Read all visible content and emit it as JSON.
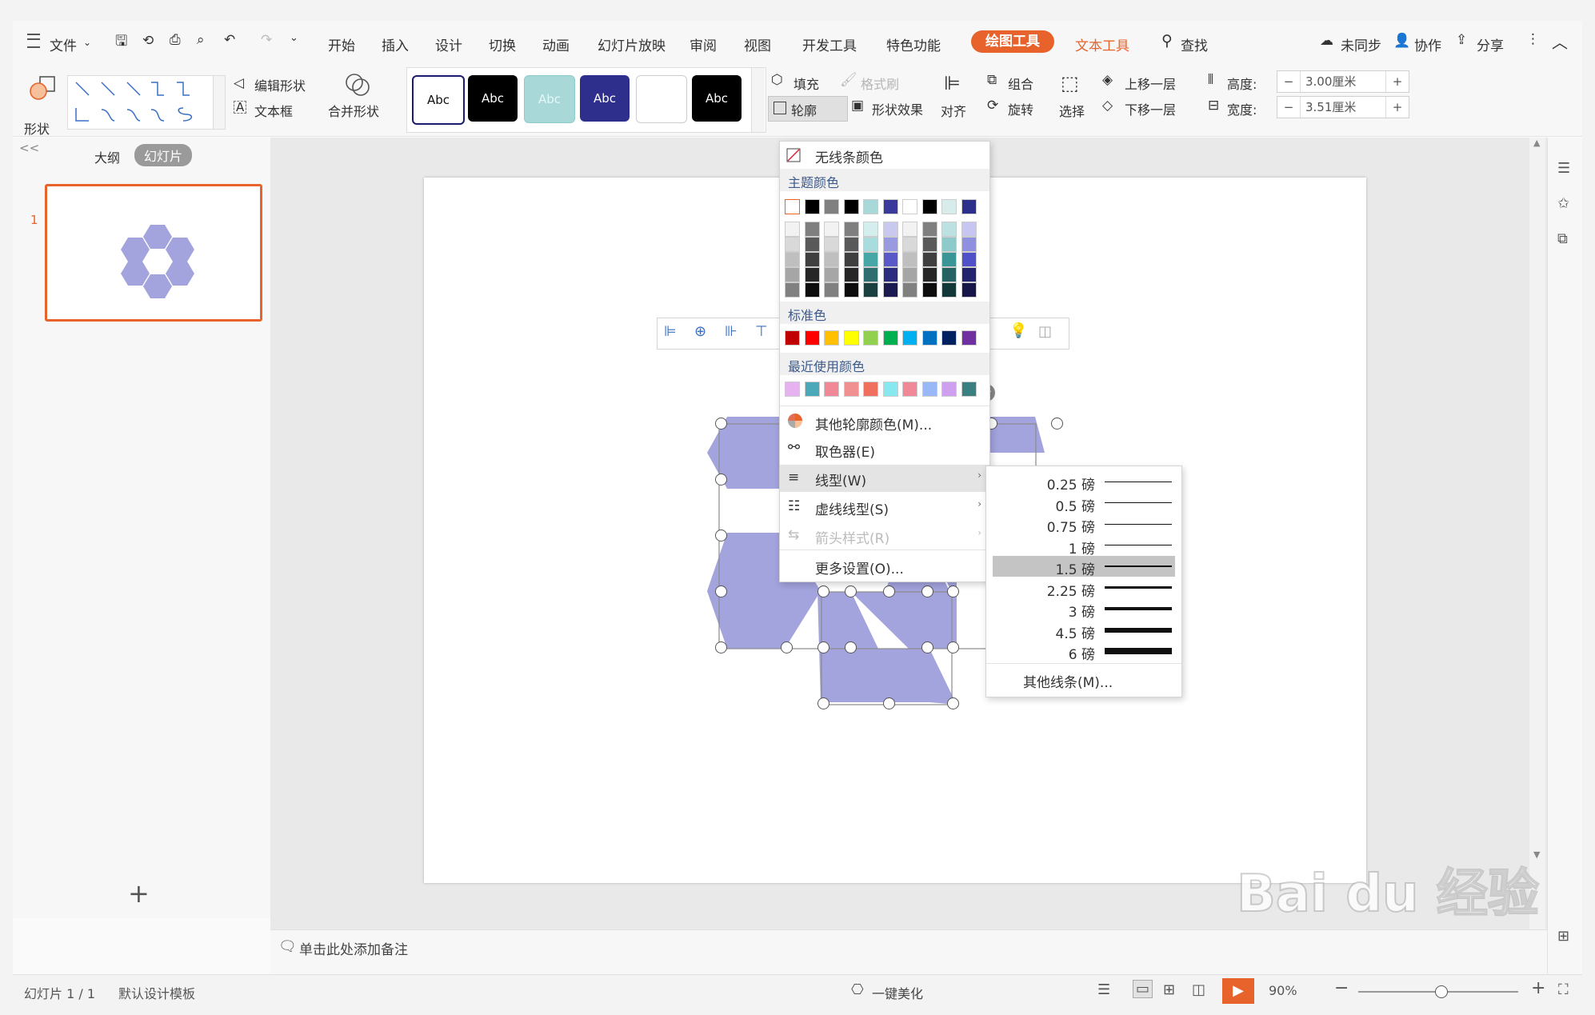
{
  "menubar": {
    "file": "文件",
    "tabs": [
      "开始",
      "插入",
      "设计",
      "切换",
      "动画",
      "幻灯片放映",
      "审阅",
      "视图",
      "开发工具",
      "特色功能"
    ],
    "active_tab": "绘图工具",
    "text_tool": "文本工具",
    "search": "查找",
    "sync": "未同步",
    "collab": "协作",
    "share": "分享"
  },
  "ribbon": {
    "shape": "形状",
    "edit_shape": "编辑形状",
    "textbox": "文本框",
    "merge_shape": "合并形状",
    "style_sample": "Abc",
    "fill": "填充",
    "format_painter": "格式刷",
    "outline": "轮廓",
    "shape_effect": "形状效果",
    "align": "对齐",
    "group": "组合",
    "rotate": "旋转",
    "select": "选择",
    "bring_forward": "上移一层",
    "send_backward": "下移一层",
    "height_label": "高度:",
    "height_value": "3.00厘米",
    "width_label": "宽度:",
    "width_value": "3.51厘米",
    "minus": "−",
    "plus": "+"
  },
  "left_panel": {
    "outline_tab": "大纲",
    "slides_tab": "幻灯片",
    "slide_number": "1",
    "add": "+",
    "collapse": "<<"
  },
  "notes": {
    "placeholder": "单击此处添加备注"
  },
  "status": {
    "slide_info": "幻灯片 1 / 1",
    "template": "默认设计模板",
    "beautify": "一键美化",
    "zoom": "90%"
  },
  "dropdown": {
    "no_line": "无线条颜色",
    "theme_colors": "主题颜色",
    "standard_colors": "标准色",
    "recent_colors": "最近使用颜色",
    "more_colors": "其他轮廓颜色(M)...",
    "eyedropper": "取色器(E)",
    "line_type": "线型(W)",
    "dash_type": "虚线线型(S)",
    "arrow_style": "箭头样式(R)",
    "more_settings": "更多设置(O)...",
    "theme_top": [
      "#ffffff",
      "#000000",
      "#808080",
      "#000000",
      "#a8d8d8",
      "#3a3a9c",
      "#ffffff",
      "#000000",
      "#d8ecec",
      "#2e2e8c"
    ],
    "theme_shades": [
      [
        "#f2f2f2",
        "#7f7f7f",
        "#f2f2f2",
        "#7f7f7f",
        "#d4eeee",
        "#c9c9ef",
        "#f2f2f2",
        "#7f7f7f",
        "#bde0e0",
        "#c6c6f0"
      ],
      [
        "#d9d9d9",
        "#595959",
        "#d9d9d9",
        "#595959",
        "#a9dcdc",
        "#9a9ae0",
        "#d9d9d9",
        "#595959",
        "#8fcaca",
        "#9090e0"
      ],
      [
        "#bfbfbf",
        "#3f3f3f",
        "#bfbfbf",
        "#3f3f3f",
        "#47a7a7",
        "#5959c8",
        "#bfbfbf",
        "#3f3f3f",
        "#3a9696",
        "#5050c8"
      ],
      [
        "#a6a6a6",
        "#262626",
        "#a6a6a6",
        "#262626",
        "#2e6e6e",
        "#2b2b80",
        "#a6a6a6",
        "#262626",
        "#256363",
        "#23236e"
      ],
      [
        "#808080",
        "#0d0d0d",
        "#808080",
        "#0d0d0d",
        "#1a4040",
        "#1b1b52",
        "#808080",
        "#0d0d0d",
        "#133838",
        "#161648"
      ]
    ],
    "standard": [
      "#c00000",
      "#ff0000",
      "#ffc000",
      "#ffff00",
      "#92d050",
      "#00b050",
      "#00b0f0",
      "#0070c0",
      "#002060",
      "#7030a0"
    ],
    "recent": [
      "#e6b3f0",
      "#4aa8b8",
      "#f08898",
      "#f09090",
      "#f07060",
      "#88e8f0",
      "#f08898",
      "#98b8f8",
      "#d0a0f0",
      "#3a8080"
    ]
  },
  "line_weights": [
    {
      "label": "0.25 磅",
      "w": 0.25
    },
    {
      "label": "0.5 磅",
      "w": 0.5
    },
    {
      "label": "0.75 磅",
      "w": 0.75
    },
    {
      "label": "1 磅",
      "w": 1
    },
    {
      "label": "1.5 磅",
      "w": 1.5
    },
    {
      "label": "2.25 磅",
      "w": 2.25
    },
    {
      "label": "3 磅",
      "w": 3
    },
    {
      "label": "4.5 磅",
      "w": 4.5
    },
    {
      "label": "6 磅",
      "w": 6
    }
  ],
  "selected_weight": "1.5 磅",
  "more_lines": "其他线条(M)...",
  "colors": {
    "accent": "#e8632b",
    "hexagon": "#a3a3dd",
    "selected_row": "#c4c4c4"
  }
}
